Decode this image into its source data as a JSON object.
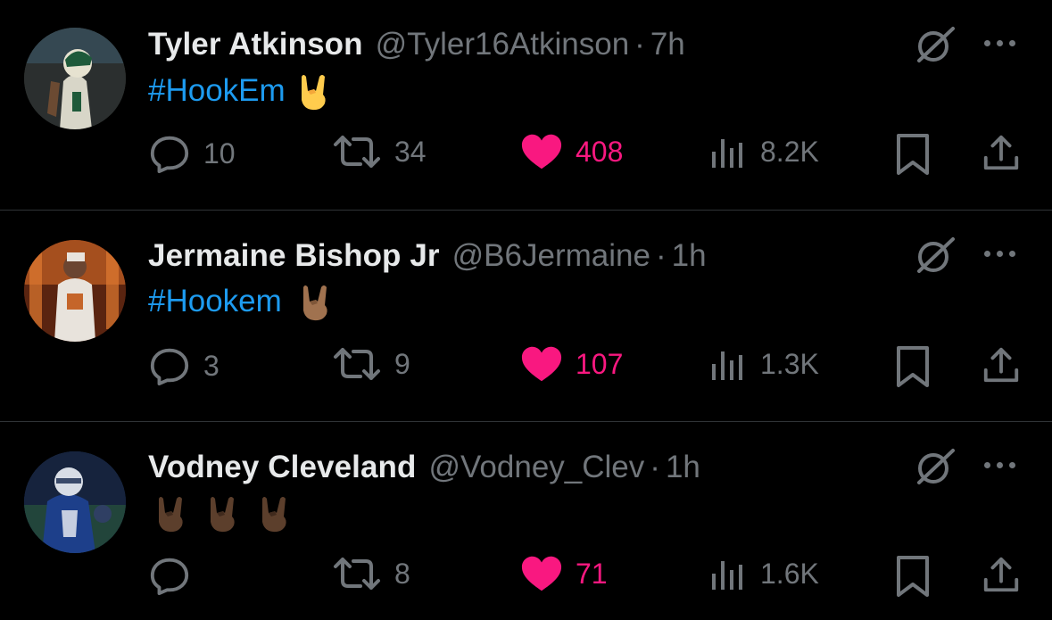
{
  "colors": {
    "background": "#000000",
    "text_primary": "#e7e9ea",
    "text_secondary": "#71767b",
    "hashtag": "#1d9bf0",
    "like_active": "#f91880",
    "divider": "#2f3336"
  },
  "tweets": [
    {
      "name": "Tyler Atkinson",
      "handle": "@Tyler16Atkinson",
      "separator": "·",
      "time": "7h",
      "text": "#HookEm",
      "emoji": "sign-of-horns-light",
      "emoji_count": 1,
      "replies": "10",
      "retweets": "34",
      "likes": "408",
      "views": "8.2K",
      "liked": true
    },
    {
      "name": "Jermaine Bishop Jr",
      "handle": "@B6Jermaine",
      "separator": "·",
      "time": "1h",
      "text": "#Hookem",
      "emoji": "sign-of-horns-medium-dark",
      "emoji_count": 1,
      "replies": "3",
      "retweets": "9",
      "likes": "107",
      "views": "1.3K",
      "liked": true
    },
    {
      "name": "Vodney Cleveland",
      "handle": "@Vodney_Clev",
      "separator": "·",
      "time": "1h",
      "text": "",
      "emoji": "sign-of-horns-dark",
      "emoji_count": 3,
      "replies": "",
      "retweets": "8",
      "likes": "71",
      "views": "1.6K",
      "liked": true
    }
  ],
  "icons": {
    "reply": "reply-icon",
    "retweet": "retweet-icon",
    "like": "heart-icon",
    "views": "views-icon",
    "bookmark": "bookmark-icon",
    "share": "share-icon",
    "grok": "grok-icon",
    "more": "more-icon"
  }
}
